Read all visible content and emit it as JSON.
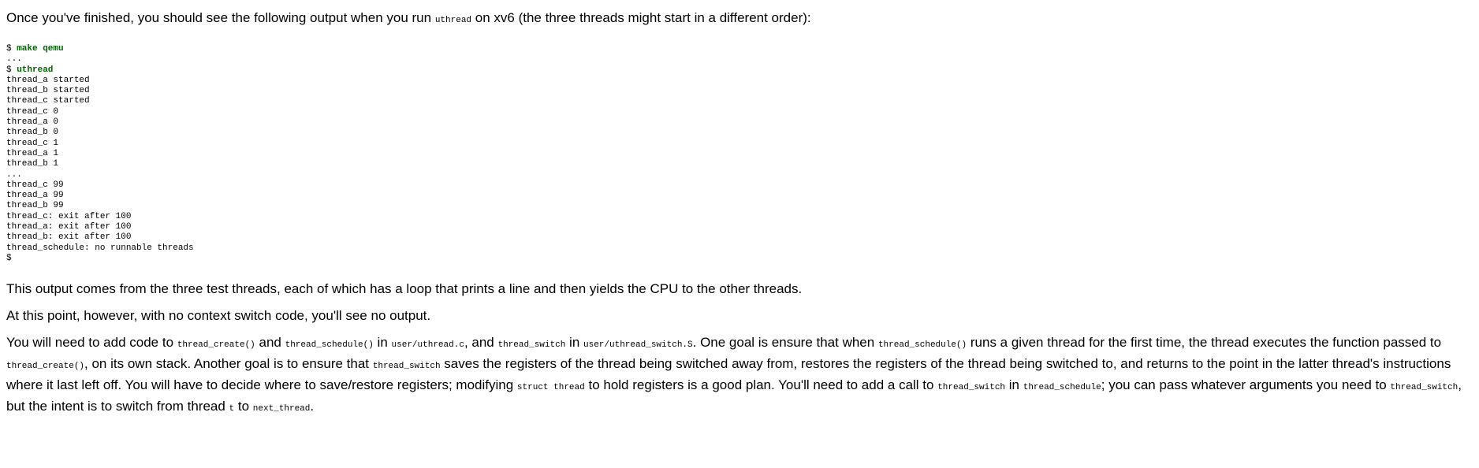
{
  "intro": {
    "t1": "Once you've finished, you should see the following output when you run ",
    "c1": "uthread",
    "t2": " on xv6 (the three threads might start in a different order):"
  },
  "terminal": {
    "prompt1": "$ ",
    "cmd1": "make qemu",
    "ellipsis1": "...",
    "prompt2": "$ ",
    "cmd2": "uthread",
    "output_lines": [
      "thread_a started",
      "thread_b started",
      "thread_c started",
      "thread_c 0",
      "thread_a 0",
      "thread_b 0",
      "thread_c 1",
      "thread_a 1",
      "thread_b 1",
      "...",
      "thread_c 99",
      "thread_a 99",
      "thread_b 99",
      "thread_c: exit after 100",
      "thread_a: exit after 100",
      "thread_b: exit after 100",
      "thread_schedule: no runnable threads",
      "$"
    ]
  },
  "p_output": "This output comes from the three test threads, each of which has a loop that prints a line and then yields the CPU to the other threads.",
  "p_point": "At this point, however, with no context switch code, you'll see no output.",
  "task": {
    "t1": "You will need to add code to ",
    "c1": "thread_create()",
    "t2": " and ",
    "c2": "thread_schedule()",
    "t3": " in ",
    "c3": "user/uthread.c",
    "t4": ", and ",
    "c4": "thread_switch",
    "t5": " in ",
    "c5": "user/uthread_switch.S",
    "t6": ". One goal is ensure that when ",
    "c6": "thread_schedule()",
    "t7": " runs a given thread for the first time, the thread executes the function passed to ",
    "c7": "thread_create()",
    "t8": ", on its own stack. Another goal is to ensure that ",
    "c8": "thread_switch",
    "t9": " saves the registers of the thread being switched away from, restores the registers of the thread being switched to, and returns to the point in the latter thread's instructions where it last left off. You will have to decide where to save/restore registers; modifying ",
    "c9": "struct thread",
    "t10": " to hold registers is a good plan. You'll need to add a call to ",
    "c10": "thread_switch",
    "t11": " in ",
    "c11": "thread_schedule",
    "t12": "; you can pass whatever arguments you need to ",
    "c12": "thread_switch",
    "t13": ", but the intent is to switch from thread ",
    "c13": "t",
    "t14": " to ",
    "c14": "next_thread",
    "t15": "."
  }
}
